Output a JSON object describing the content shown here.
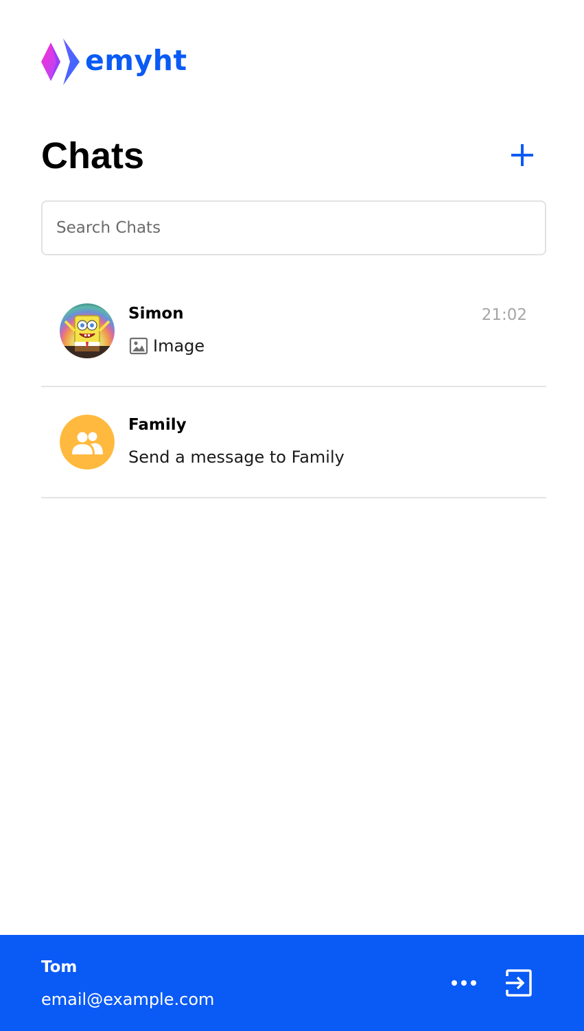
{
  "brand": {
    "name": "emyht",
    "logo_icon": "emyht-logo-icon",
    "gradient_colors": [
      "#ff2bd1",
      "#9b4dff",
      "#2f6bff"
    ],
    "accent_color": "#0a5af5"
  },
  "header": {
    "title": "Chats",
    "new_chat_icon": "plus-icon"
  },
  "search": {
    "placeholder": "Search Chats",
    "value": ""
  },
  "chats": [
    {
      "name": "Simon",
      "time": "21:02",
      "preview_icon": "image-icon",
      "preview": "Image",
      "avatar": "spongebob-avatar"
    },
    {
      "name": "Family",
      "time": "",
      "preview": "Send a message to Family",
      "avatar": "group-icon",
      "avatar_color": "#ffb93e"
    }
  ],
  "footer": {
    "user_name": "Tom",
    "user_email": "email@example.com",
    "more_icon": "more-horizontal-icon",
    "logout_icon": "logout-icon",
    "background": "#0a5af5"
  }
}
